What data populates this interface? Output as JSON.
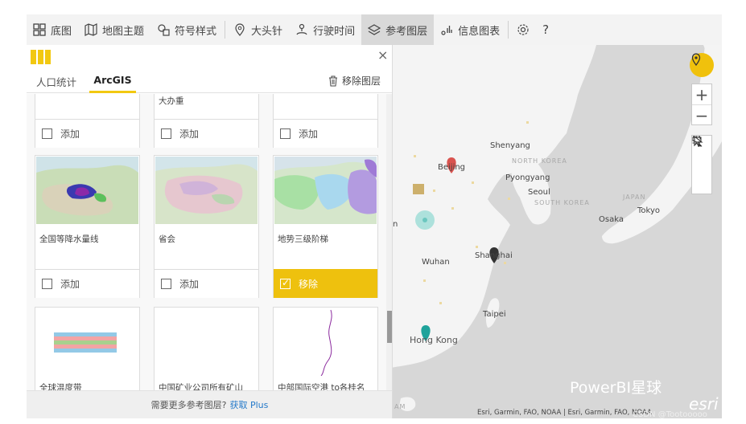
{
  "toolbar": {
    "items": [
      {
        "label": "底图",
        "icon": "basemap-grid-icon"
      },
      {
        "label": "地图主题",
        "icon": "map-theme-icon"
      },
      {
        "label": "符号样式",
        "icon": "symbol-style-icon"
      },
      {
        "label": "大头针",
        "icon": "pin-icon"
      },
      {
        "label": "行驶时间",
        "icon": "drive-time-icon"
      },
      {
        "label": "参考图层",
        "icon": "reference-layer-icon",
        "active": true
      },
      {
        "label": "信息图表",
        "icon": "infographic-icon"
      }
    ],
    "settings_icon": "gear-icon",
    "help": "?"
  },
  "panel": {
    "tabs": [
      "人口统计",
      "ArcGIS"
    ],
    "active_tab": "ArcGIS",
    "remove_layer_label": "移除图层",
    "close": "×",
    "cards": [
      {
        "title": "大办重",
        "action": "添加",
        "checked": false
      },
      {
        "title": "",
        "action": "添加",
        "checked": false
      },
      {
        "title": "",
        "action": "添加",
        "checked": false
      },
      {
        "title": "全国等降水量线",
        "action": "添加",
        "checked": false
      },
      {
        "title": "省会",
        "action": "添加",
        "checked": false
      },
      {
        "title": "地势三级阶梯",
        "action": "移除",
        "checked": true
      },
      {
        "title": "全球温度带",
        "action": "",
        "checked": false
      },
      {
        "title": "中国矿业公司所有矿山",
        "action": "",
        "checked": false
      },
      {
        "title": "中部国际空港 to各桂名",
        "action": "",
        "checked": false
      }
    ],
    "footer_text": "需要更多参考图层?",
    "footer_link": "获取 Plus"
  },
  "map": {
    "labels": {
      "shenyang": "Shenyang",
      "beijing": "Beijing",
      "north_korea": "NORTH KOREA",
      "pyongyang": "Pyongyang",
      "seoul": "Seoul",
      "south_korea": "SOUTH KOREA",
      "japan": "JAPAN",
      "tokyo": "Tokyo",
      "osaka": "Osaka",
      "wuhan": "Wuhan",
      "shanghai": "Shanghai",
      "taipei": "Taipei",
      "hong_kong": "Hong Kong",
      "edge_n": "n",
      "edge_am": "AM"
    },
    "attribution": "Esri, Garmin, FAO, NOAA | Esri, Garmin, FAO, NOAA",
    "watermark_brand": "PowerBI星球",
    "watermark_esri": "esri",
    "watermark_csdn": "CSDN @Tootooooo",
    "zoom_in": "+",
    "zoom_out": "−",
    "colors": {
      "land": "#f4f4f4",
      "water": "#d7d7d7",
      "accent": "#f2c811",
      "teal": "#1fa39b",
      "red_pin": "#d9534f"
    }
  }
}
